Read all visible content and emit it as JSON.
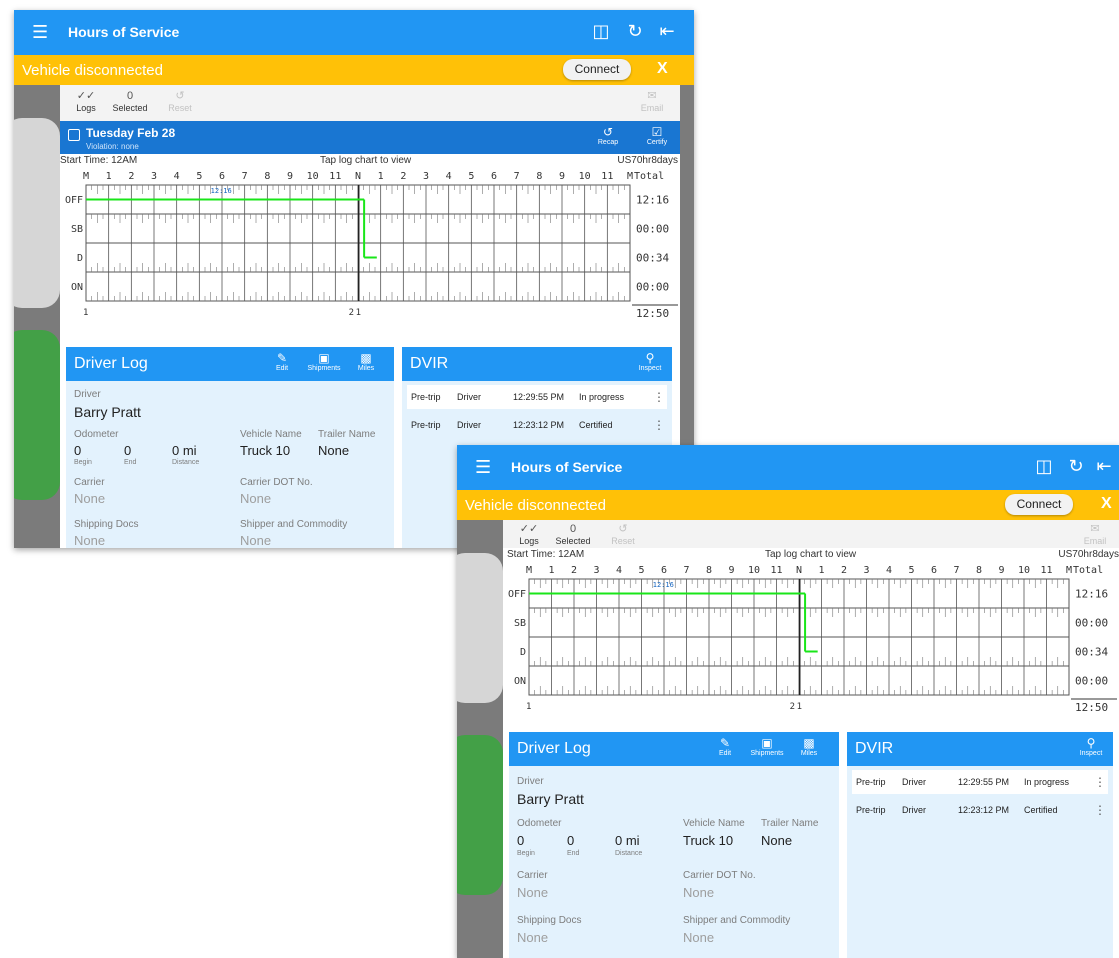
{
  "app": {
    "title": "Hours of Service",
    "menu_icon": "hamburger-menu-icon",
    "icons": [
      "device-disconnect-icon",
      "refresh-icon",
      "logout-icon"
    ]
  },
  "banner": {
    "message": "Vehicle disconnected",
    "connect_label": "Connect",
    "close_label": "X"
  },
  "toolbar": {
    "logs_label": "Logs",
    "selected_count": "0",
    "selected_label": "Selected",
    "reset_label": "Reset",
    "email_label": "Email"
  },
  "day": {
    "date": "Tuesday Feb 28",
    "violation": "Violation: none",
    "recap_label": "Recap",
    "certify_label": "Certify"
  },
  "graph": {
    "start_time": "Start Time: 12AM",
    "tap_hint": "Tap log chart to view",
    "cycle": "US70hr8days",
    "hours": [
      "M",
      "1",
      "2",
      "3",
      "4",
      "5",
      "6",
      "7",
      "8",
      "9",
      "10",
      "11",
      "N",
      "1",
      "2",
      "3",
      "4",
      "5",
      "6",
      "7",
      "8",
      "9",
      "10",
      "11",
      "M"
    ],
    "total_label": "Total",
    "statuses": [
      "OFF",
      "SB",
      "D",
      "ON"
    ],
    "totals": [
      "12:16",
      "00:00",
      "00:34",
      "00:00"
    ],
    "grand_total": "12:50",
    "marker_time": "12:16",
    "left_marker": "1",
    "mid_marker": "2",
    "mid_marker_alt": "1",
    "segments": [
      {
        "status": "OFF",
        "from_hour": 0,
        "to_hour": 12.27
      },
      {
        "status": "D",
        "from_hour": 12.27,
        "to_hour": 12.83
      }
    ],
    "current_hour": 12.03,
    "colors": {
      "line": "#19e619",
      "grid": "#555555",
      "now": "#222222",
      "marker": "#1565c0"
    }
  },
  "driver_log": {
    "title": "Driver Log",
    "edit_label": "Edit",
    "shipments_label": "Shipments",
    "miles_label": "Miles",
    "driver_label": "Driver",
    "driver_name": "Barry Pratt",
    "odometer_label": "Odometer",
    "begin_value": "0",
    "begin_label": "Begin",
    "end_value": "0",
    "end_label": "End",
    "distance_value": "0 mi",
    "distance_label": "Distance",
    "vehicle_label": "Vehicle Name",
    "vehicle_value": "Truck 10",
    "trailer_label": "Trailer Name",
    "trailer_value": "None",
    "carrier_label": "Carrier",
    "carrier_value": "None",
    "dot_label": "Carrier DOT No.",
    "dot_value": "None",
    "shipping_label": "Shipping Docs",
    "shipping_value": "None",
    "shipper_label": "Shipper and Commodity",
    "shipper_value": "None"
  },
  "dvir": {
    "title": "DVIR",
    "inspect_label": "Inspect",
    "rows": [
      {
        "type": "Pre-trip",
        "by": "Driver",
        "time": "12:29:55 PM",
        "status": "In progress"
      },
      {
        "type": "Pre-trip",
        "by": "Driver",
        "time": "12:23:12 PM",
        "status": "Certified"
      }
    ]
  },
  "colors": {
    "primary": "#2196f3",
    "header_dark": "#1976d2",
    "warning": "#ffc107",
    "card_bg": "#e3f2fd"
  }
}
